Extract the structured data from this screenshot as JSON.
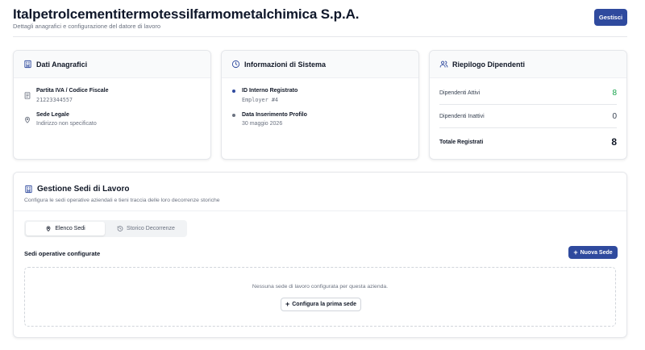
{
  "header": {
    "title": "Italpetrolcementitermotessilfarmometalchimica S.p.A.",
    "subtitle": "Dettagli anagrafici e configurazione del datore di lavoro",
    "manage_label": "Gestisci"
  },
  "anagrafici": {
    "title": "Dati Anagrafici",
    "vat_label": "Partita IVA / Codice Fiscale",
    "vat_value": "21223344557",
    "seat_label": "Sede Legale",
    "seat_value": "Indirizzo non specificato"
  },
  "sistema": {
    "title": "Informazioni di Sistema",
    "id_label": "ID Interno Registrato",
    "id_value": "Employer #4",
    "date_label": "Data Inserimento Profilo",
    "date_value": "30 maggio 2026"
  },
  "dipendenti": {
    "title": "Riepilogo Dipendenti",
    "active_label": "Dipendenti Attivi",
    "active_value": "8",
    "inactive_label": "Dipendenti Inattivi",
    "inactive_value": "0",
    "total_label": "Totale Registrati",
    "total_value": "8"
  },
  "sedi": {
    "title": "Gestione Sedi di Lavoro",
    "subtitle": "Configura le sedi operative aziendali e tieni traccia delle loro decorrenze storiche",
    "tabs": [
      {
        "label": "Elenco Sedi"
      },
      {
        "label": "Storico Decorrenze"
      }
    ],
    "list_label": "Sedi operative configurate",
    "new_label": "Nuova Sede",
    "empty_text": "Nessuna sede di lavoro configurata per questa azienda.",
    "first_label": "Configura la prima sede"
  },
  "colors": {
    "primary": "#2f4a9e",
    "success": "#16a34a",
    "dot_blue": "#2f4a9e",
    "dot_gray": "#6b7280"
  }
}
